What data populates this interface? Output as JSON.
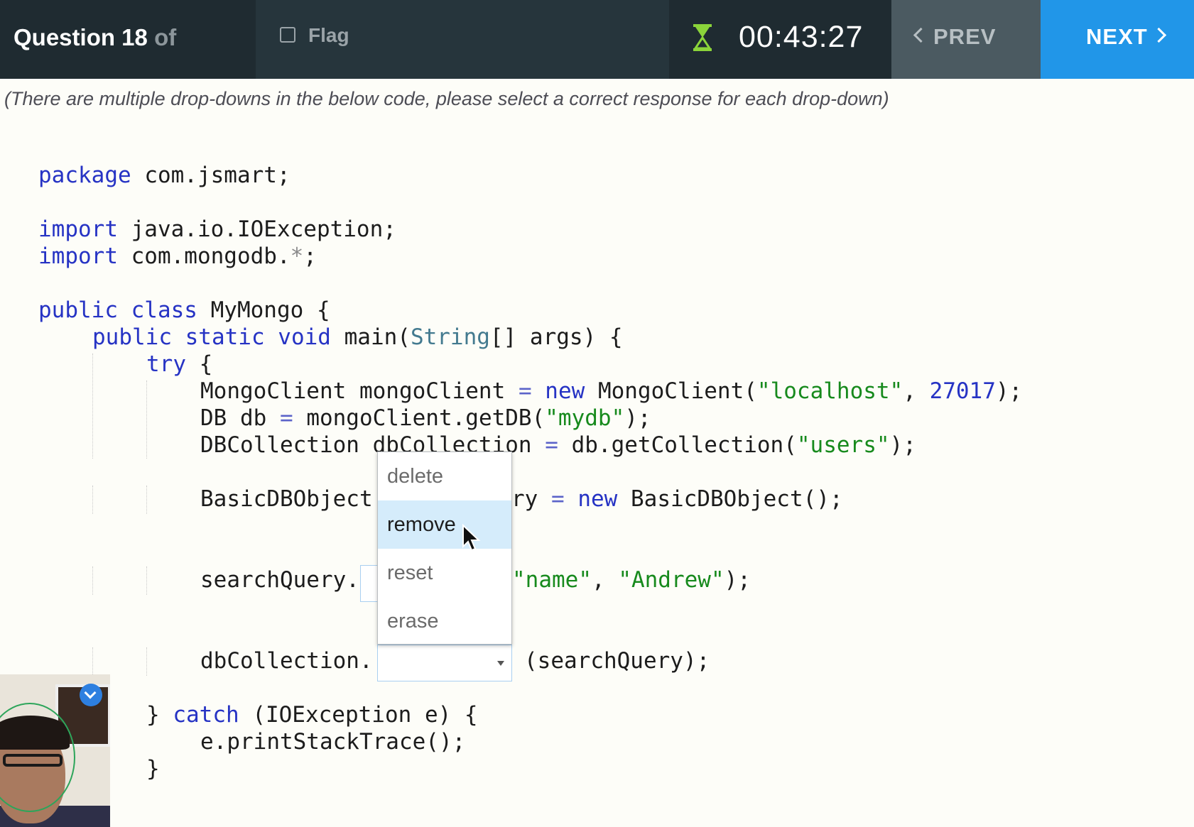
{
  "header": {
    "question_label": "Question 18",
    "question_of": "of",
    "flag_label": "Flag",
    "timer": "00:43:27",
    "prev_label": "PREV",
    "next_label": "NEXT"
  },
  "instruction": "(There are multiple drop-downs in the below code, please select a correct response for each drop-down)",
  "code": {
    "l1_kw": "package",
    "l1_rest": " com.jsmart;",
    "l2_kw": "import",
    "l2_rest": " java.io.IOException;",
    "l3_kw": "import",
    "l3_rest": " com.mongodb.",
    "l3_star": "*",
    "l3_end": ";",
    "l4_kw": "public class",
    "l4_rest": " MyMongo {",
    "l5_kw": "public static void",
    "l5_mid": " main(",
    "l5_type": "String",
    "l5_end": "[] args) {",
    "l6_kw": "try",
    "l6_rest": " {",
    "l7_a": "MongoClient mongoClient ",
    "l7_eq": "=",
    "l7_sp": " ",
    "l7_new": "new",
    "l7_b": " MongoClient(",
    "l7_str": "\"localhost\"",
    "l7_c": ", ",
    "l7_num": "27017",
    "l7_d": ");",
    "l8_a": "DB db ",
    "l8_eq": "=",
    "l8_b": " mongoClient.getDB(",
    "l8_str": "\"mydb\"",
    "l8_c": ");",
    "l9_a": "DBCollection dbCollection ",
    "l9_eq": "=",
    "l9_b": " db.getCollection(",
    "l9_str": "\"users\"",
    "l9_c": ");",
    "l10_a": "BasicDBObject",
    "l10_b": "ry ",
    "l10_eq": "=",
    "l10_sp": " ",
    "l10_new": "new",
    "l10_c": " BasicDBObject();",
    "l11_a": "searchQuery.",
    "l11_str1": "\"name\"",
    "l11_b": ", ",
    "l11_str2": "\"Andrew\"",
    "l11_c": ");",
    "l12_a": "dbCollection.",
    "l12_b": "(searchQuery);",
    "l13_a": "} ",
    "l13_kw": "catch",
    "l13_b": " (IOException e) {",
    "l14_a": "e.printStackTrace();",
    "l15_a": "}"
  },
  "dropdown": {
    "options": [
      "delete",
      "remove",
      "reset",
      "erase"
    ],
    "highlighted": "remove"
  },
  "colors": {
    "topbar": "#1f2b31",
    "next_button": "#2196e8",
    "prev_button": "#4b5a61",
    "hourglass": "#8bd43a",
    "keyword": "#2633c4",
    "string": "#178a1d"
  }
}
